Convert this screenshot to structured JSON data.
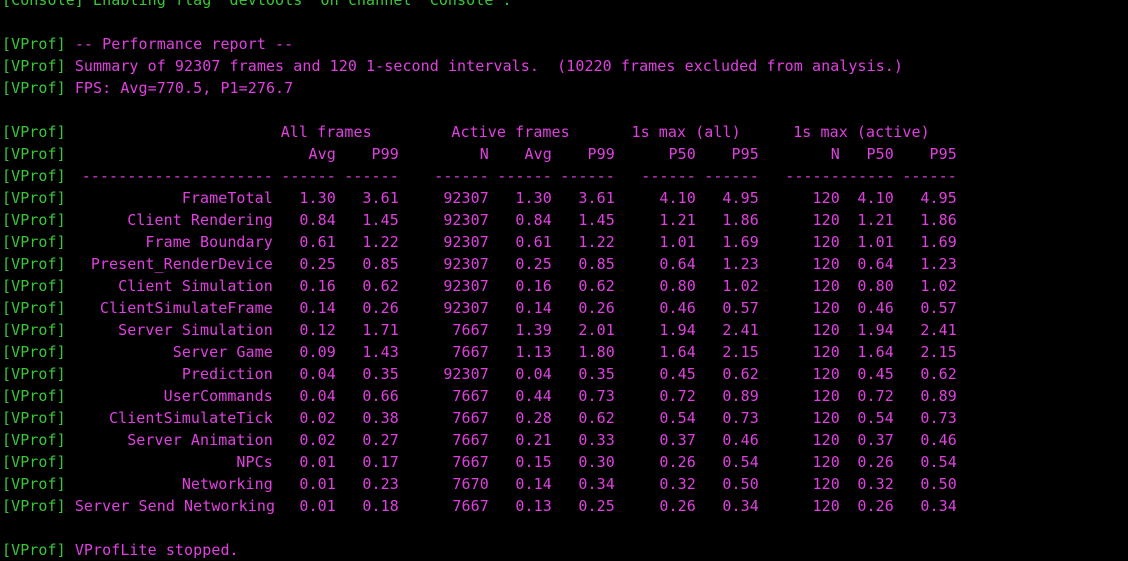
{
  "console": {
    "tag": "[VProf]",
    "top_line": "[Console] Enabling flag 'devtools' on channel 'Console'.",
    "report_header": "-- Performance report --",
    "summary": "Summary of 92307 frames and 120 1-second intervals.  (10220 frames excluded from analysis.)",
    "fps": "FPS: Avg=770.5, P1=276.7",
    "footer": "VProfLite stopped."
  },
  "table": {
    "group_headers": [
      "All frames",
      "Active frames",
      "1s max (all)",
      "1s max (active)"
    ],
    "columns": [
      "Avg",
      "P99",
      "N",
      "Avg",
      "P99",
      "P50",
      "P95",
      "N",
      "P50",
      "P95"
    ],
    "separator_label": "---------------------",
    "separator_cells": [
      "------",
      "------",
      "------",
      "------",
      "------",
      "------",
      "------",
      "------",
      "------",
      "------"
    ],
    "rows": [
      {
        "label": "FrameTotal",
        "values": [
          "1.30",
          "3.61",
          "92307",
          "1.30",
          "3.61",
          "4.10",
          "4.95",
          "120",
          "4.10",
          "4.95"
        ]
      },
      {
        "label": "Client Rendering",
        "values": [
          "0.84",
          "1.45",
          "92307",
          "0.84",
          "1.45",
          "1.21",
          "1.86",
          "120",
          "1.21",
          "1.86"
        ]
      },
      {
        "label": "Frame Boundary",
        "values": [
          "0.61",
          "1.22",
          "92307",
          "0.61",
          "1.22",
          "1.01",
          "1.69",
          "120",
          "1.01",
          "1.69"
        ]
      },
      {
        "label": "Present_RenderDevice",
        "values": [
          "0.25",
          "0.85",
          "92307",
          "0.25",
          "0.85",
          "0.64",
          "1.23",
          "120",
          "0.64",
          "1.23"
        ]
      },
      {
        "label": "Client Simulation",
        "values": [
          "0.16",
          "0.62",
          "92307",
          "0.16",
          "0.62",
          "0.80",
          "1.02",
          "120",
          "0.80",
          "1.02"
        ]
      },
      {
        "label": "ClientSimulateFrame",
        "values": [
          "0.14",
          "0.26",
          "92307",
          "0.14",
          "0.26",
          "0.46",
          "0.57",
          "120",
          "0.46",
          "0.57"
        ]
      },
      {
        "label": "Server Simulation",
        "values": [
          "0.12",
          "1.71",
          "7667",
          "1.39",
          "2.01",
          "1.94",
          "2.41",
          "120",
          "1.94",
          "2.41"
        ]
      },
      {
        "label": "Server Game",
        "values": [
          "0.09",
          "1.43",
          "7667",
          "1.13",
          "1.80",
          "1.64",
          "2.15",
          "120",
          "1.64",
          "2.15"
        ]
      },
      {
        "label": "Prediction",
        "values": [
          "0.04",
          "0.35",
          "92307",
          "0.04",
          "0.35",
          "0.45",
          "0.62",
          "120",
          "0.45",
          "0.62"
        ]
      },
      {
        "label": "UserCommands",
        "values": [
          "0.04",
          "0.66",
          "7667",
          "0.44",
          "0.73",
          "0.72",
          "0.89",
          "120",
          "0.72",
          "0.89"
        ]
      },
      {
        "label": "ClientSimulateTick",
        "values": [
          "0.02",
          "0.38",
          "7667",
          "0.28",
          "0.62",
          "0.54",
          "0.73",
          "120",
          "0.54",
          "0.73"
        ]
      },
      {
        "label": "Server Animation",
        "values": [
          "0.02",
          "0.27",
          "7667",
          "0.21",
          "0.33",
          "0.37",
          "0.46",
          "120",
          "0.37",
          "0.46"
        ]
      },
      {
        "label": "NPCs",
        "values": [
          "0.01",
          "0.17",
          "7667",
          "0.15",
          "0.30",
          "0.26",
          "0.54",
          "120",
          "0.26",
          "0.54"
        ]
      },
      {
        "label": "Networking",
        "values": [
          "0.01",
          "0.23",
          "7670",
          "0.14",
          "0.34",
          "0.32",
          "0.50",
          "120",
          "0.32",
          "0.50"
        ]
      },
      {
        "label": "Server Send Networking",
        "values": [
          "0.01",
          "0.18",
          "7667",
          "0.13",
          "0.25",
          "0.26",
          "0.34",
          "120",
          "0.26",
          "0.34"
        ]
      }
    ]
  },
  "colors": {
    "background": "#000000",
    "tag_green": "#36c836",
    "text_magenta": "#e040e0"
  }
}
